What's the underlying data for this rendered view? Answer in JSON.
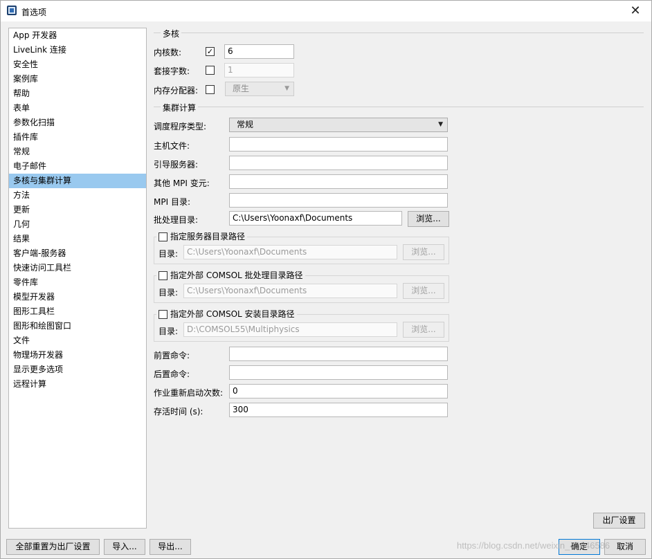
{
  "window": {
    "title": "首选项"
  },
  "nav": {
    "items": [
      "App 开发器",
      "LiveLink 连接",
      "安全性",
      "案例库",
      "帮助",
      "表单",
      "参数化扫描",
      "插件库",
      "常规",
      "电子邮件",
      "多核与集群计算",
      "方法",
      "更新",
      "几何",
      "结果",
      "客户端-服务器",
      "快速访问工具栏",
      "零件库",
      "模型开发器",
      "图形工具栏",
      "图形和绘图窗口",
      "文件",
      "物理场开发器",
      "显示更多选项",
      "远程计算"
    ],
    "selected": "多核与集群计算"
  },
  "multicore": {
    "section_title": "多核",
    "cores_label": "内核数:",
    "cores_checked": true,
    "cores_value": "6",
    "sockets_label": "套接字数:",
    "sockets_checked": false,
    "sockets_value": "1",
    "alloc_label": "内存分配器:",
    "alloc_checked": false,
    "alloc_value": "原生"
  },
  "cluster": {
    "section_title": "集群计算",
    "scheduler_label": "调度程序类型:",
    "scheduler_value": "常规",
    "host_label": "主机文件:",
    "host_value": "",
    "boot_label": "引导服务器:",
    "boot_value": "",
    "mpi_args_label": "其他 MPI 变元:",
    "mpi_args_value": "",
    "mpi_dir_label": "MPI 目录:",
    "mpi_dir_value": "",
    "batch_dir_label": "批处理目录:",
    "batch_dir_value": "C:\\Users\\Yoonaxf\\Documents",
    "browse_label": "浏览...",
    "server_dir_title": "指定服务器目录路径",
    "server_dir_label": "目录:",
    "server_dir_value": "C:\\Users\\Yoonaxf\\Documents",
    "ext_batch_title": "指定外部 COMSOL 批处理目录路径",
    "ext_batch_label": "目录:",
    "ext_batch_value": "C:\\Users\\Yoonaxf\\Documents",
    "ext_install_title": "指定外部 COMSOL 安装目录路径",
    "ext_install_label": "目录:",
    "ext_install_value": "D:\\COMSOL55\\Multiphysics",
    "pre_cmd_label": "前置命令:",
    "pre_cmd_value": "",
    "post_cmd_label": "后置命令:",
    "post_cmd_value": "",
    "restart_label": "作业重新启动次数:",
    "restart_value": "0",
    "alive_label": "存活时间 (s):",
    "alive_value": "300"
  },
  "footer": {
    "factory_label": "出厂设置",
    "reset_all_label": "全部重置为出厂设置",
    "import_label": "导入...",
    "export_label": "导出...",
    "ok_label": "确定",
    "cancel_label": "取消",
    "watermark": "https://blog.csdn.net/weixin_43046586"
  }
}
